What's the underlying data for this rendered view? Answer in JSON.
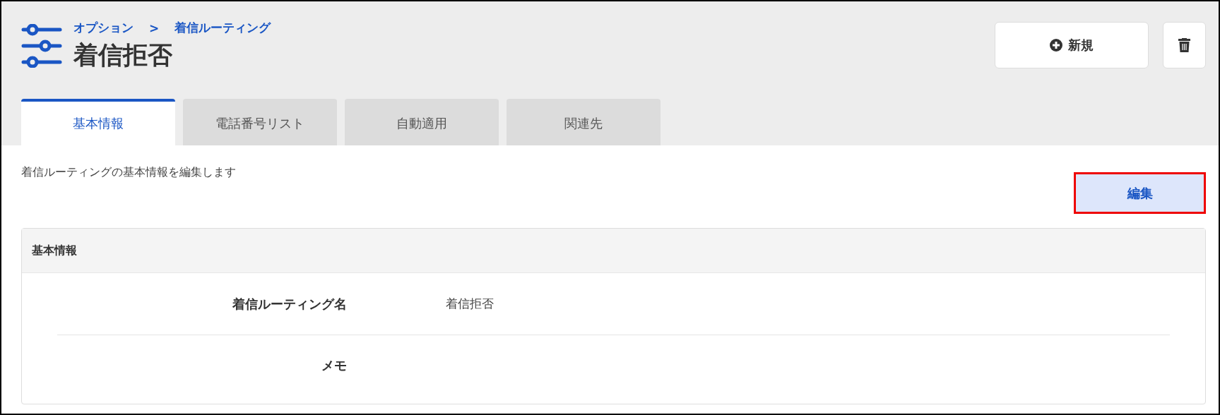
{
  "breadcrumb": [
    "オプション",
    ">",
    "着信ルーティング"
  ],
  "title": "着信拒否",
  "header_buttons": [
    {
      "kind": "new",
      "label": "新規"
    },
    {
      "kind": "delete"
    }
  ],
  "tabs": [
    {
      "label": "基本情報",
      "selected": true
    },
    {
      "label": "電話番号リスト",
      "selected": false
    },
    {
      "label": "自動適用",
      "selected": false
    },
    {
      "label": "関連先",
      "selected": false
    }
  ],
  "description": "着信ルーティングの基本情報を編集します",
  "edit_button": {
    "label": "編集",
    "highlighted": true
  },
  "section": {
    "title": "基本情報",
    "fields": [
      {
        "label": "着信ルーティング名",
        "value": "着信拒否"
      },
      {
        "label": "メモ"
      }
    ]
  }
}
